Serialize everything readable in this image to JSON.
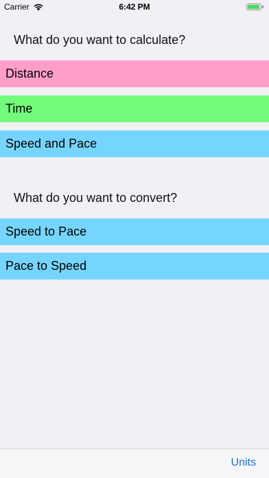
{
  "status_bar": {
    "carrier": "Carrier",
    "time": "6:42 PM",
    "battery_level": 0.95,
    "battery_color": "#4cd964"
  },
  "calculate": {
    "header": "What do you want to calculate?",
    "items": [
      {
        "label": "Distance",
        "color": "#ff9fc9"
      },
      {
        "label": "Time",
        "color": "#73fc7b"
      },
      {
        "label": "Speed and Pace",
        "color": "#76d5fe"
      }
    ]
  },
  "convert": {
    "header": "What do you want to convert?",
    "items": [
      {
        "label": "Speed to Pace",
        "color": "#76d5fe"
      },
      {
        "label": "Pace to Speed",
        "color": "#76d5fe"
      }
    ]
  },
  "toolbar": {
    "units_label": "Units",
    "accent_color": "#1a73e0"
  },
  "icons": {
    "wifi": "wifi-icon",
    "battery": "battery-icon"
  }
}
